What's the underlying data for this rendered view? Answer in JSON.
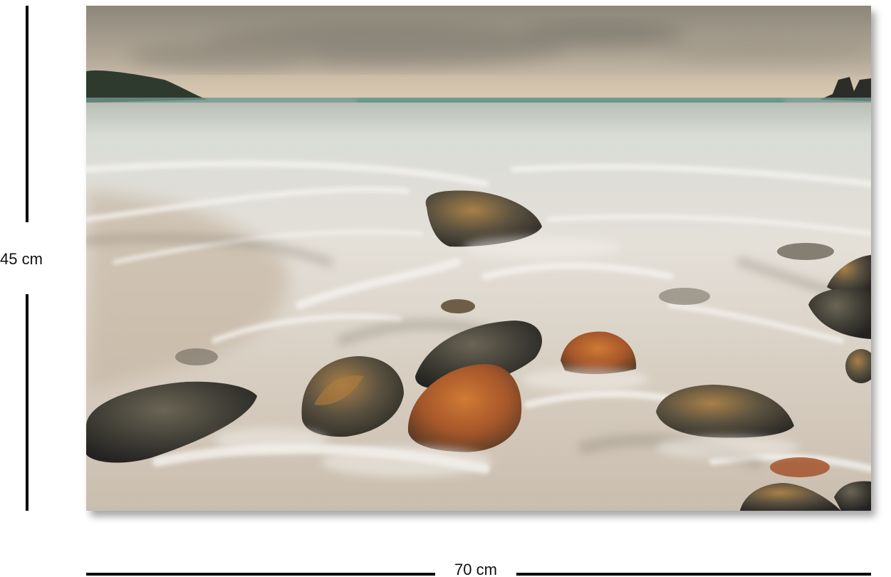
{
  "dimensions": {
    "height_label": "45 cm",
    "width_label": "70 cm"
  },
  "artwork": {
    "subject": "long-exposure-seascape",
    "colors": {
      "sky_top": "#8a8476",
      "sky_horizon": "#d8c8b2",
      "sea_line": "#5e8f88",
      "surf": "#e6e2da",
      "sand": "#cdbfae",
      "rock_dark": "#3a3a34",
      "rock_orange": "#b8642a"
    }
  }
}
